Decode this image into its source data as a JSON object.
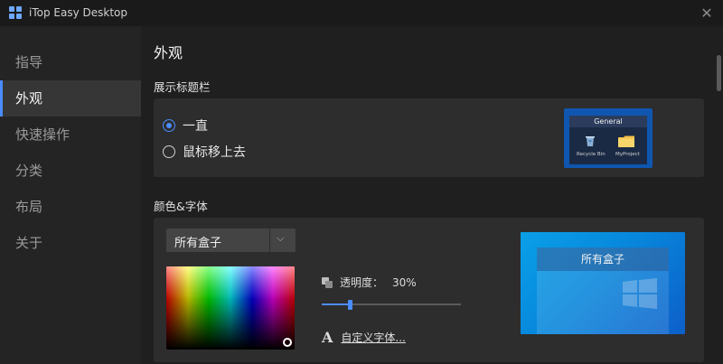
{
  "window": {
    "title": "iTop Easy Desktop"
  },
  "sidebar": {
    "items": [
      {
        "label": "指导",
        "active": false
      },
      {
        "label": "外观",
        "active": true
      },
      {
        "label": "快速操作",
        "active": false
      },
      {
        "label": "分类",
        "active": false
      },
      {
        "label": "布局",
        "active": false
      },
      {
        "label": "关于",
        "active": false
      }
    ]
  },
  "main": {
    "title": "外观",
    "title_bar_section": {
      "label": "展示标题栏",
      "options": [
        {
          "label": "一直",
          "checked": true
        },
        {
          "label": "鼠标移上去",
          "checked": false
        }
      ],
      "preview": {
        "header": "General",
        "icons": [
          {
            "label": "Recycle Bin",
            "icon": "recycle-bin-icon"
          },
          {
            "label": "MyProject",
            "icon": "folder-icon"
          }
        ]
      }
    },
    "color_font_section": {
      "label": "颜色&字体",
      "dropdown_value": "所有盒子",
      "opacity_label": "透明度：",
      "opacity_value": "30%",
      "opacity_fraction": 0.3,
      "custom_font_link": "自定义字体...",
      "preview_box_title": "所有盒子"
    }
  },
  "colors": {
    "accent": "#4a8cff",
    "sidebar_bg": "#242424",
    "panel_bg": "#2d2d2d",
    "preview_blue": "#0787dc"
  }
}
